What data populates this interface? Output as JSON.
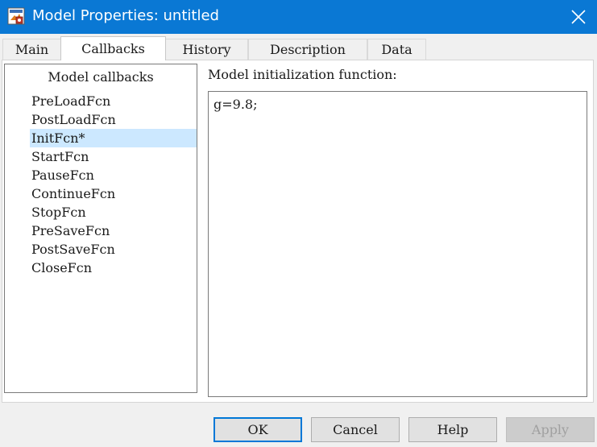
{
  "window": {
    "title": "Model Properties: untitled",
    "icon": "model-properties-icon",
    "close_icon": "close-icon",
    "titlebar_color": "#0a78d4"
  },
  "tabs": [
    {
      "label": "Main",
      "active": false
    },
    {
      "label": "Callbacks",
      "active": true
    },
    {
      "label": "History",
      "active": false
    },
    {
      "label": "Description",
      "active": false
    },
    {
      "label": "Data",
      "active": false
    }
  ],
  "callbacks": {
    "header": "Model callbacks",
    "items": [
      {
        "label": "PreLoadFcn"
      },
      {
        "label": "PostLoadFcn"
      },
      {
        "label": "InitFcn*",
        "selected": true
      },
      {
        "label": "StartFcn"
      },
      {
        "label": "PauseFcn"
      },
      {
        "label": "ContinueFcn"
      },
      {
        "label": "StopFcn"
      },
      {
        "label": "PreSaveFcn"
      },
      {
        "label": "PostSaveFcn"
      },
      {
        "label": "CloseFcn"
      }
    ],
    "selection_color": "#cce8ff"
  },
  "editor": {
    "label": "Model initialization function:",
    "code": "g=9.8;"
  },
  "buttons": {
    "ok": "OK",
    "cancel": "Cancel",
    "help": "Help",
    "apply": "Apply",
    "apply_enabled": false
  }
}
